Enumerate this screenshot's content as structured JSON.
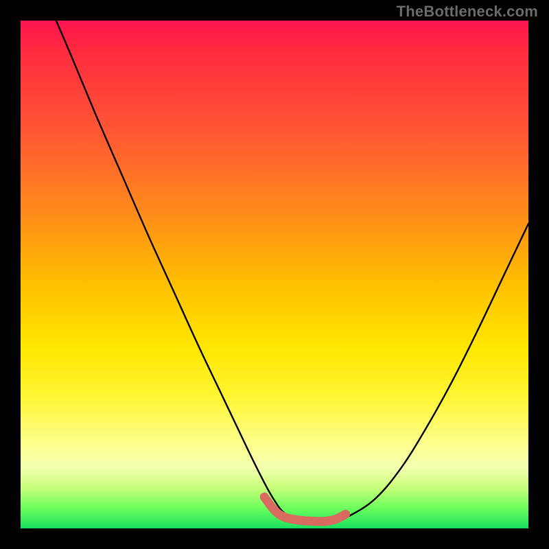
{
  "watermark": "TheBottleneck.com",
  "chart_data": {
    "type": "line",
    "title": "",
    "xlabel": "",
    "ylabel": "",
    "xlim": [
      0,
      100
    ],
    "ylim": [
      0,
      100
    ],
    "grid": false,
    "legend": false,
    "series": [
      {
        "name": "curve",
        "x": [
          7,
          10,
          15,
          20,
          25,
          30,
          35,
          40,
          45,
          48,
          50,
          52,
          55,
          58,
          60,
          62,
          65,
          70,
          75,
          80,
          85,
          90,
          95,
          100
        ],
        "y": [
          100,
          93,
          81,
          69.5,
          58,
          47,
          36,
          25.5,
          15,
          9,
          5.5,
          3,
          1.8,
          1.4,
          1.4,
          1.7,
          2.6,
          6,
          12,
          20,
          29,
          39,
          49.5,
          60
        ]
      }
    ],
    "highlight_segment": {
      "name": "bottom-plateau",
      "x": [
        48,
        50,
        52,
        55,
        58,
        60,
        62,
        64
      ],
      "y": [
        6.2,
        3.6,
        2.2,
        1.6,
        1.4,
        1.4,
        1.8,
        2.8
      ]
    }
  },
  "background_gradient": {
    "stops": [
      {
        "pos": 0,
        "color": "#ff1450"
      },
      {
        "pos": 22,
        "color": "#ff5733"
      },
      {
        "pos": 52,
        "color": "#ffc000"
      },
      {
        "pos": 74,
        "color": "#fff533"
      },
      {
        "pos": 92,
        "color": "#c8ff7a"
      },
      {
        "pos": 100,
        "color": "#19e060"
      }
    ]
  }
}
